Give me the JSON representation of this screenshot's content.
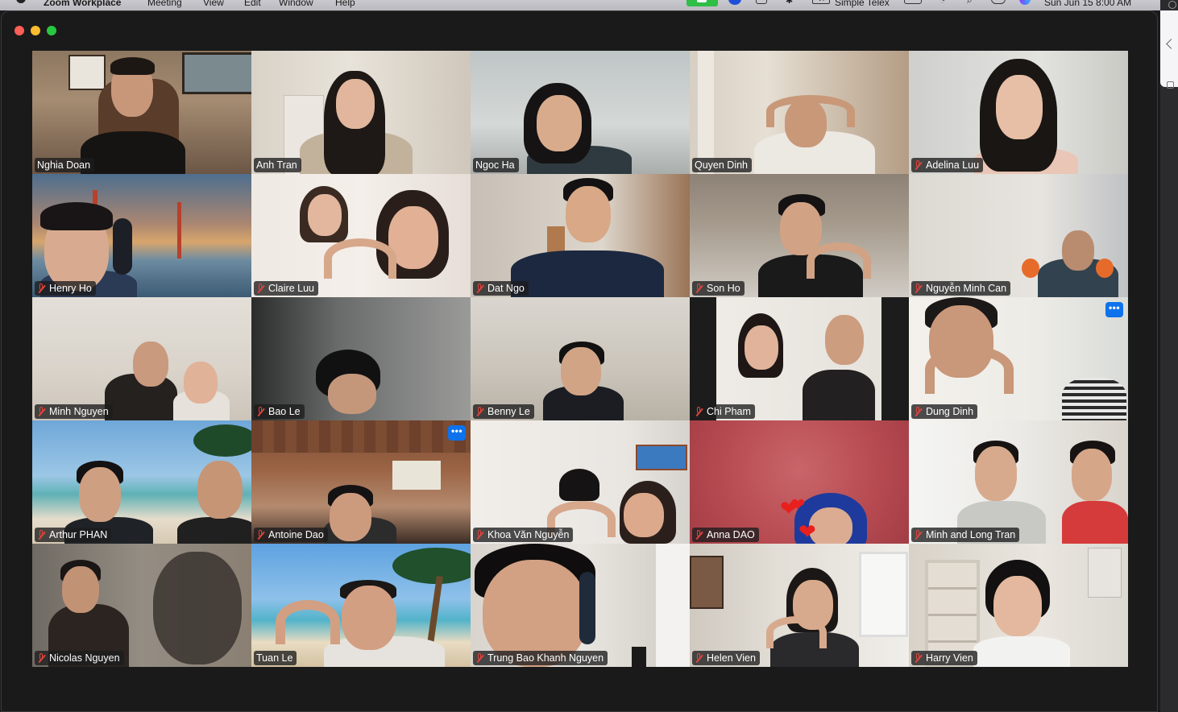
{
  "menubar": {
    "app_name": "Zoom Workplace",
    "menus": [
      "Meeting",
      "View",
      "Edit",
      "Window",
      "Help"
    ],
    "input_source": "VI",
    "input_method": "Simple Telex",
    "clock": "Sun Jun 15  8:00 AM"
  },
  "window": {
    "controls": [
      "close",
      "minimize",
      "maximize"
    ]
  },
  "participants": [
    {
      "name": "Nghia Doan",
      "muted": false
    },
    {
      "name": "Anh Tran",
      "muted": false
    },
    {
      "name": "Ngoc Ha",
      "muted": false,
      "active_speaker": true
    },
    {
      "name": "Quyen Dinh",
      "muted": false
    },
    {
      "name": "Adelina Luu",
      "muted": true
    },
    {
      "name": "Henry Ho",
      "muted": true
    },
    {
      "name": "Claire Luu",
      "muted": true
    },
    {
      "name": "Dat Ngo",
      "muted": true
    },
    {
      "name": "Son Ho",
      "muted": true
    },
    {
      "name": "Nguyễn Minh Can",
      "muted": true
    },
    {
      "name": "Minh Nguyen",
      "muted": true
    },
    {
      "name": "Bao Le",
      "muted": true
    },
    {
      "name": "Benny Le",
      "muted": true
    },
    {
      "name": "Chi Pham",
      "muted": true
    },
    {
      "name": "Dung Dinh",
      "muted": true,
      "more_button": true
    },
    {
      "name": "Arthur PHAN",
      "muted": true
    },
    {
      "name": "Antoine Dao",
      "muted": true,
      "more_button": true
    },
    {
      "name": "Khoa Văn Nguyễn",
      "muted": true
    },
    {
      "name": "Anna DAO",
      "muted": true
    },
    {
      "name": "Minh and Long Tran",
      "muted": true
    },
    {
      "name": "Nicolas Nguyen",
      "muted": true
    },
    {
      "name": "Tuan Le",
      "muted": false
    },
    {
      "name": "Trung Bao Khanh Nguyen",
      "muted": true
    },
    {
      "name": "Helen Vien",
      "muted": true
    },
    {
      "name": "Harry Vien",
      "muted": true
    }
  ],
  "more_button_label": "•••",
  "colors": {
    "active_speaker_border": "#35c759",
    "muted_icon": "#e0443b",
    "more_button": "#0e72ed"
  },
  "icons": [
    "apple-icon",
    "zoom-video-icon",
    "zoom-chat-icon",
    "bluetooth-icon",
    "battery-icon",
    "wifi-icon",
    "spotlight-search-icon",
    "control-center-icon",
    "siri-icon",
    "microphone-muted-icon"
  ]
}
